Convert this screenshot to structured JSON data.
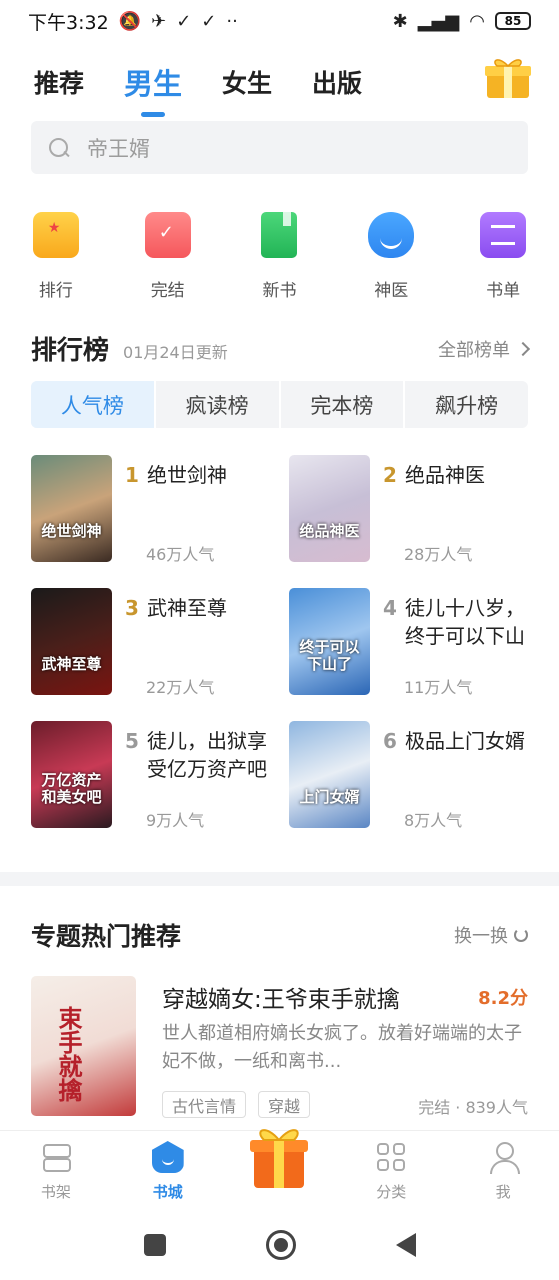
{
  "status_bar": {
    "time": "下午3:32",
    "icons": [
      "mute-icon",
      "telegram-icon",
      "check-icon",
      "check-icon",
      "more-icon"
    ],
    "right_icons": [
      "bluetooth-icon",
      "signal-icon",
      "wifi-icon"
    ],
    "battery": "85"
  },
  "top_tabs": [
    {
      "label": "推荐",
      "active": false
    },
    {
      "label": "男生",
      "active": true
    },
    {
      "label": "女生",
      "active": false
    },
    {
      "label": "出版",
      "active": false
    }
  ],
  "search": {
    "placeholder": "帝王婿"
  },
  "quick_entries": [
    {
      "label": "排行",
      "icon": "rank-icon"
    },
    {
      "label": "完结",
      "icon": "completed-icon"
    },
    {
      "label": "新书",
      "icon": "new-book-icon"
    },
    {
      "label": "神医",
      "icon": "doctor-icon"
    },
    {
      "label": "书单",
      "icon": "booklist-icon"
    }
  ],
  "ranking": {
    "title": "排行榜",
    "update_date": "01月24日更新",
    "all_label": "全部榜单",
    "tabs": [
      {
        "label": "人气榜",
        "active": true
      },
      {
        "label": "疯读榜",
        "active": false
      },
      {
        "label": "完本榜",
        "active": false
      },
      {
        "label": "飙升榜",
        "active": false
      }
    ],
    "items": [
      {
        "rank": "1",
        "title": "绝世剑神",
        "heat": "46万人气",
        "cover_text": "绝世剑神",
        "cover_colors": [
          "#6a8c7a",
          "#c9a37a",
          "#3a2a22"
        ]
      },
      {
        "rank": "2",
        "title": "绝品神医",
        "heat": "28万人气",
        "cover_text": "绝品神医",
        "cover_colors": [
          "#e8e6ef",
          "#c7bfd6",
          "#d7bcd0"
        ]
      },
      {
        "rank": "3",
        "title": "武神至尊",
        "heat": "22万人气",
        "cover_text": "武神至尊",
        "cover_colors": [
          "#1a1a1a",
          "#4a1f1a",
          "#7a1410"
        ]
      },
      {
        "rank": "4",
        "title": "徒儿十八岁，终于可以下山了",
        "heat": "11万人气",
        "cover_text": "终于可以下山了",
        "cover_colors": [
          "#4a8fd8",
          "#9fc6ef",
          "#2b66b5"
        ]
      },
      {
        "rank": "5",
        "title": "徒儿，出狱享受亿万资产吧",
        "heat": "9万人气",
        "cover_text": "万亿资产和美女吧",
        "cover_colors": [
          "#6b1d2a",
          "#c83a55",
          "#2a1a20"
        ]
      },
      {
        "rank": "6",
        "title": "极品上门女婿",
        "heat": "8万人气",
        "cover_text": "上门女婿",
        "cover_colors": [
          "#8fb6e0",
          "#e8eef5",
          "#5a86c4"
        ]
      }
    ]
  },
  "topic": {
    "title": "专题热门推荐",
    "refresh_label": "换一换",
    "book": {
      "title": "穿越嫡女:王爷束手就擒",
      "score": "8.2分",
      "description": "世人都道相府嫡长女疯了。放着好端端的太子妃不做，一纸和离书...",
      "tags": [
        "古代言情",
        "穿越"
      ],
      "meta": "完结 · 839人气",
      "cover_text": "束手就擒"
    }
  },
  "bottom_nav": [
    {
      "label": "书架",
      "icon": "bookshelf-icon",
      "active": false
    },
    {
      "label": "书城",
      "icon": "bookstore-icon",
      "active": true
    },
    {
      "label": "",
      "icon": "gift-icon",
      "active": false
    },
    {
      "label": "分类",
      "icon": "category-icon",
      "active": false
    },
    {
      "label": "我",
      "icon": "profile-icon",
      "active": false
    }
  ],
  "colors": {
    "accent": "#2f8be6",
    "rank_gold": "#c8962e",
    "score": "#e36d2b"
  }
}
